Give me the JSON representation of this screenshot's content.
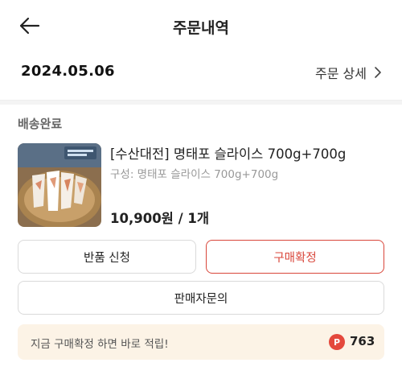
{
  "header": {
    "title": "주문내역",
    "back_icon": "arrow-left-icon"
  },
  "order": {
    "date": "2024.05.06",
    "detail_link": "주문 상세",
    "detail_icon": "chevron-right-icon",
    "status": "배송완료"
  },
  "product": {
    "name": "[수산대전] 명태포 슬라이스 700g+700g",
    "option": "구성: 명태포 슬라이스 700g+700g",
    "price": "10,900원 / 1개"
  },
  "actions": {
    "return_label": "반품 신청",
    "confirm_label": "구매확정",
    "inquiry_label": "판매자문의"
  },
  "promo": {
    "text": "지금 구매확정 하면 바로 적립!",
    "point_symbol": "P",
    "points": "763"
  },
  "colors": {
    "accent": "#d9463a",
    "promo_bg": "#fcf3e6"
  }
}
